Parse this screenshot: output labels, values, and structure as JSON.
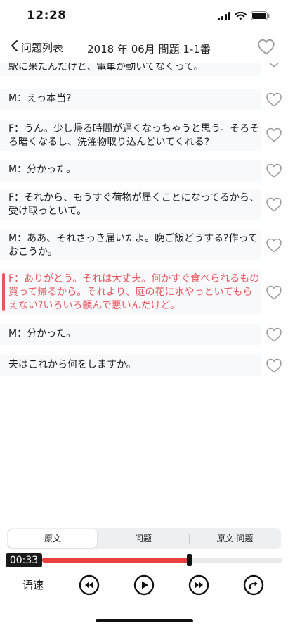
{
  "status_bar": {
    "time": "12:28"
  },
  "nav": {
    "back_label": "问题列表",
    "title": "2018 年 06月 問題 1-1番"
  },
  "transcript": {
    "lines": [
      {
        "text": "駅に来たんだけど、電車が動いてなくって。",
        "active": false
      },
      {
        "text": "M：えっ本当?",
        "active": false
      },
      {
        "text": "F：うん。少し帰る時間が遅くなっちゃうと思う。そろそろ暗くなるし、洗濯物取り込んどいてくれる?",
        "active": false
      },
      {
        "text": "M：分かった。",
        "active": false
      },
      {
        "text": "F：それから、もうすぐ荷物が届くことになってるから、受け取っといて。",
        "active": false
      },
      {
        "text": "M：ああ、それさっき届いたよ。晩ご飯どうする?作っておこうか。",
        "active": false
      },
      {
        "text": "F：ありがとう。それは大丈夫。何かすぐ食べられるもの買って帰るから。それより、庭の花に水やっといてもらえない?いろいろ頼んで悪いんだけど。",
        "active": true
      },
      {
        "text": "M：分かった。",
        "active": false
      },
      {
        "text": "夫はこれから何をしますか。",
        "active": false
      }
    ]
  },
  "tabs": {
    "items": [
      {
        "label": "原文",
        "selected": true
      },
      {
        "label": "问题",
        "selected": false
      },
      {
        "label": "原文·问题",
        "selected": false
      }
    ]
  },
  "player": {
    "current_time": "00:33",
    "progress": 0.61,
    "speed_label": "语速"
  },
  "colors": {
    "accent_red": "#e8555e",
    "progress_red": "#ea3f3f"
  }
}
